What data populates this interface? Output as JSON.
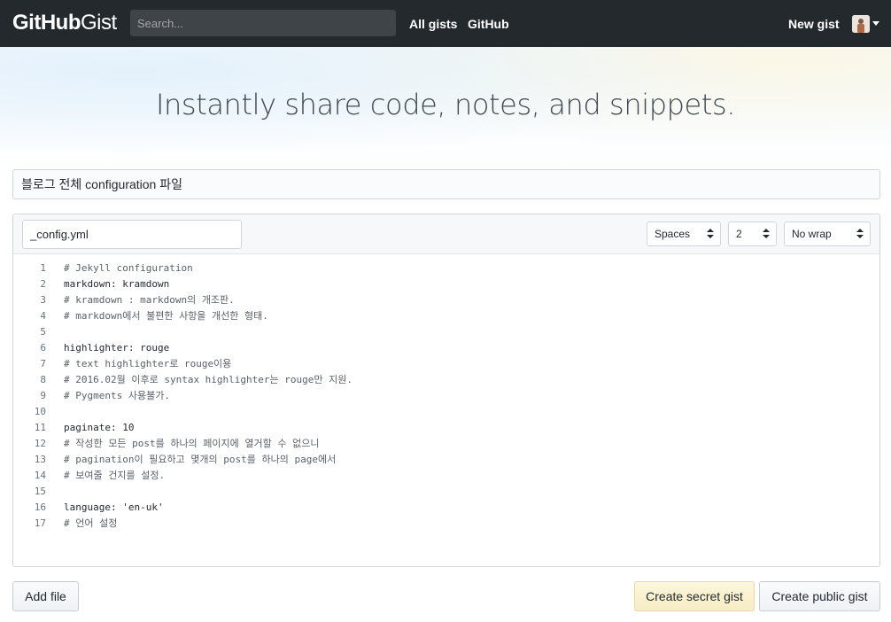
{
  "header": {
    "logo_bold": "GitHub",
    "logo_light": "Gist",
    "search_placeholder": "Search...",
    "nav": {
      "all_gists": "All gists",
      "github": "GitHub",
      "new_gist": "New gist"
    }
  },
  "hero": {
    "tagline": "Instantly share code, notes, and snippets."
  },
  "gist": {
    "description": "블로그 전체 configuration 파일",
    "filename": "_config.yml",
    "indent_mode": "Spaces",
    "indent_size": "2",
    "wrap_mode": "No wrap"
  },
  "editor": {
    "lines": [
      {
        "n": "1",
        "text": "# Jekyll configuration",
        "comment": true
      },
      {
        "n": "2",
        "text": "markdown: kramdown",
        "comment": false
      },
      {
        "n": "3",
        "text": "# kramdown : markdown의 개조판.",
        "comment": true
      },
      {
        "n": "4",
        "text": "# markdown에서 불편한 사항을 개선한 형태.",
        "comment": true
      },
      {
        "n": "5",
        "text": "",
        "comment": false
      },
      {
        "n": "6",
        "text": "highlighter: rouge",
        "comment": false
      },
      {
        "n": "7",
        "text": "# text highlighter로 rouge이용",
        "comment": true
      },
      {
        "n": "8",
        "text": "# 2016.02월 이후로 syntax highlighter는 rouge만 지원.",
        "comment": true
      },
      {
        "n": "9",
        "text": "# Pygments 사용불가.",
        "comment": true
      },
      {
        "n": "10",
        "text": "",
        "comment": false
      },
      {
        "n": "11",
        "text": "paginate: 10",
        "comment": false
      },
      {
        "n": "12",
        "text": "# 작성한 모든 post를 하나의 페이지에 열거할 수 없으니",
        "comment": true
      },
      {
        "n": "13",
        "text": "# pagination이 필요하고 몇개의 post를 하나의 page에서",
        "comment": true
      },
      {
        "n": "14",
        "text": "# 보여줄 건지를 설정.",
        "comment": true
      },
      {
        "n": "15",
        "text": "",
        "comment": false
      },
      {
        "n": "16",
        "text": "language: 'en-uk'",
        "comment": false
      },
      {
        "n": "17",
        "text": "# 언어 설정",
        "comment": true
      }
    ]
  },
  "actions": {
    "add_file": "Add file",
    "create_secret": "Create secret gist",
    "create_public": "Create public gist"
  },
  "colors": {
    "header_bg": "#24292e",
    "secret_btn": "#f7ecc3"
  }
}
